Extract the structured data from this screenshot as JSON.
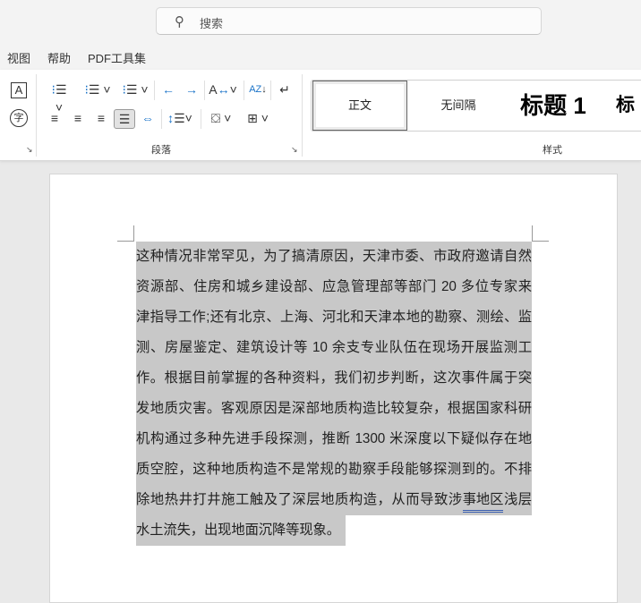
{
  "search": {
    "placeholder": "搜索",
    "icon": "search-icon"
  },
  "menu": [
    "视图",
    "帮助",
    "PDF工具集"
  ],
  "ribbon": {
    "paragraph_group": "段落",
    "styles_group": "样式",
    "styles": [
      "正文",
      "无间隔",
      "标题 1",
      "标"
    ]
  },
  "document": {
    "lines": [
      "这种情况非常罕见，为了搞清原因，天津市委、市政府邀请自然",
      "资源部、住房和城乡建设部、应急管理部等部门 20 多位专家来",
      "津指导工作;还有北京、上海、河北和天津本地的勘察、测绘、监",
      "测、房屋鉴定、建筑设计等 10 余支专业队伍在现场开展监测工",
      "作。根据目前掌握的各种资料，我们初步判断，这次事件属于突",
      "发地质灾害。客观原因是深部地质构造比较复杂，根据国家科研",
      "机构通过多种先进手段探测，推断 1300 米深度以下疑似存在地",
      "质空腔，这种地质构造不是常规的勘察手段能够探测到的。不排"
    ],
    "line9_pre": "除地热井打井施工触及了深层地质构造，从而导致涉",
    "line9_underlined": "事地区",
    "line9_post": "浅层",
    "line10": "水土流失，出现地面沉降等现象。"
  }
}
